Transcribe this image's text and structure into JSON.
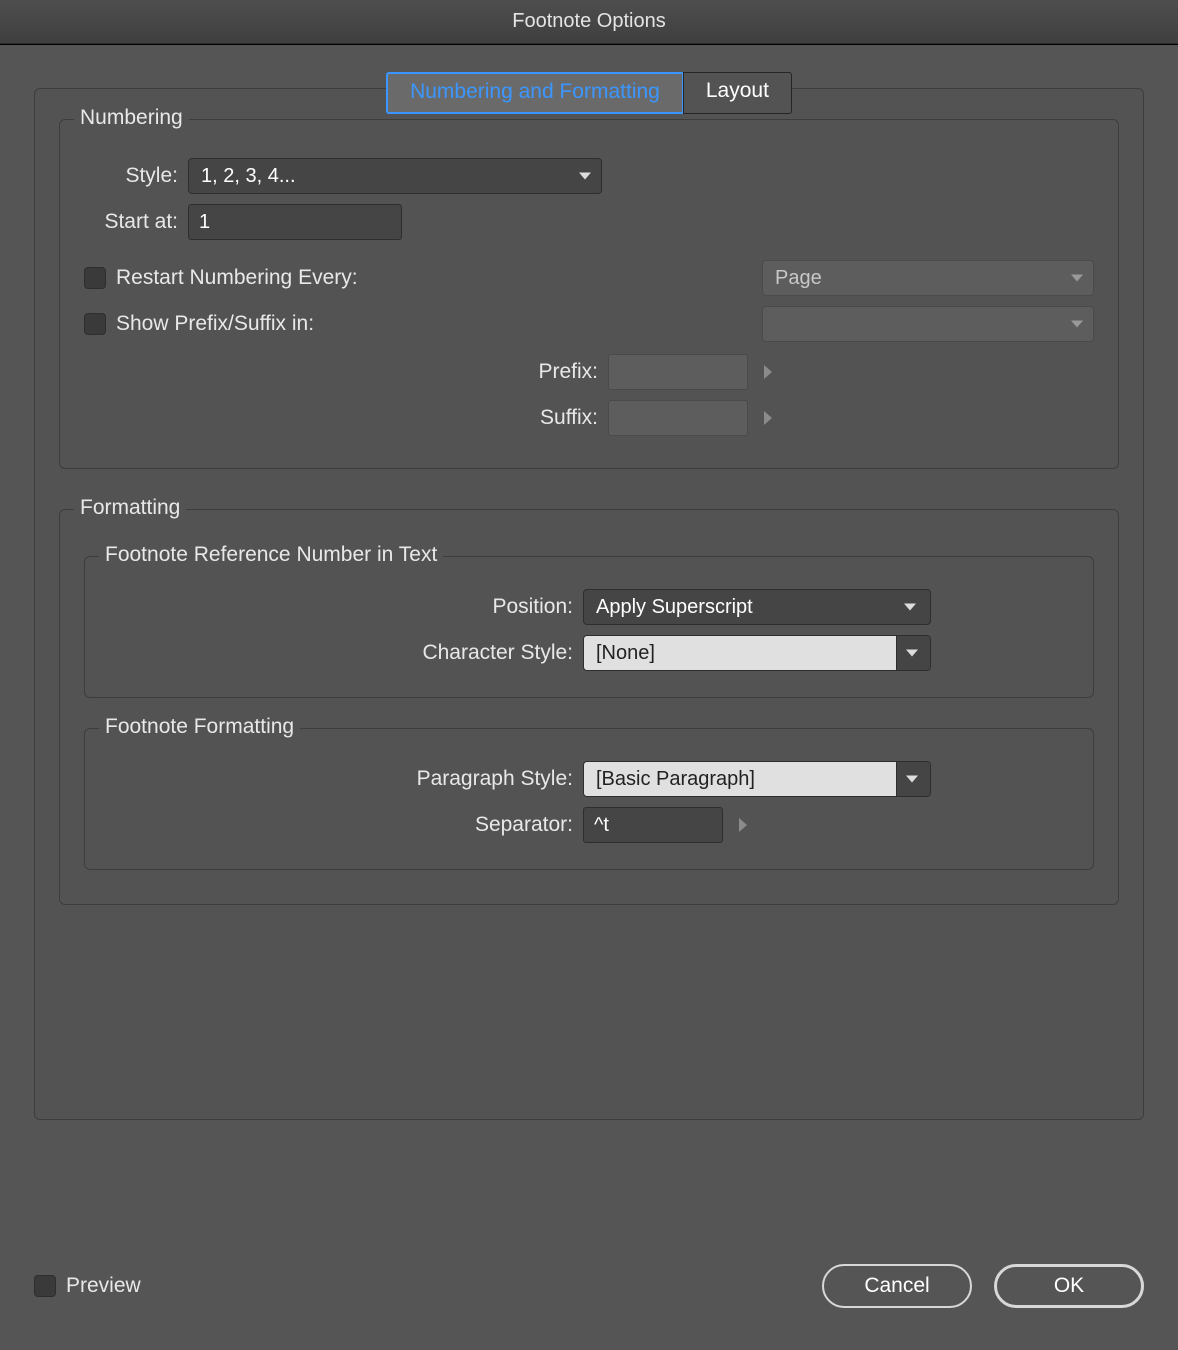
{
  "dialog": {
    "title": "Footnote Options"
  },
  "tabs": {
    "numbering": "Numbering and Formatting",
    "layout": "Layout"
  },
  "numbering": {
    "legend": "Numbering",
    "style_label": "Style:",
    "style_value": "1, 2, 3, 4...",
    "start_label": "Start at:",
    "start_value": "1",
    "restart_label": "Restart Numbering Every:",
    "restart_value": "Page",
    "showps_label": "Show Prefix/Suffix in:",
    "showps_value": "",
    "prefix_label": "Prefix:",
    "prefix_value": "",
    "suffix_label": "Suffix:",
    "suffix_value": ""
  },
  "formatting": {
    "legend": "Formatting",
    "ref": {
      "legend": "Footnote Reference Number in Text",
      "position_label": "Position:",
      "position_value": "Apply Superscript",
      "charstyle_label": "Character Style:",
      "charstyle_value": "[None]"
    },
    "foot": {
      "legend": "Footnote Formatting",
      "parastyle_label": "Paragraph Style:",
      "parastyle_value": "[Basic Paragraph]",
      "separator_label": "Separator:",
      "separator_value": "^t"
    }
  },
  "footer": {
    "preview": "Preview",
    "cancel": "Cancel",
    "ok": "OK"
  }
}
